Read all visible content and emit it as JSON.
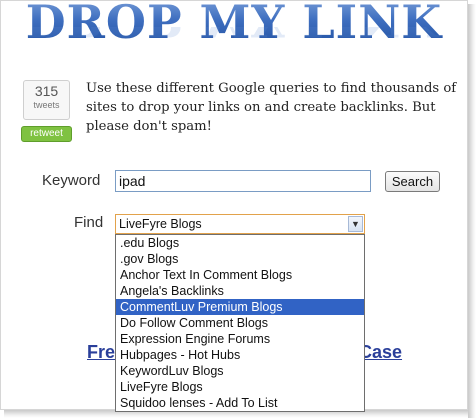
{
  "header": {
    "logo_text": "DROP MY LINK"
  },
  "tweet": {
    "count": "315",
    "count_label": "tweets",
    "button_label": "retweet"
  },
  "intro": {
    "text": "Use these different Google queries to find thousands of sites to drop your links on and create backlinks. But please don't spam!"
  },
  "form": {
    "keyword_label": "Keyword",
    "keyword_value": "ipad",
    "search_label": "Search",
    "find_label": "Find",
    "find_selected": "LiveFyre Blogs",
    "options": [
      ".edu Blogs",
      ".gov Blogs",
      "Anchor Text In Comment Blogs",
      "Angela's Backlinks",
      "CommentLuv Premium Blogs",
      "Do Follow Comment Blogs",
      "Expression Engine Forums",
      "Hubpages - Hot Hubs",
      "KeywordLuv Blogs",
      "LiveFyre Blogs",
      "Squidoo lenses - Add To List"
    ],
    "highlighted_option": "CommentLuv Premium Blogs"
  },
  "promo": {
    "left_visible": "Fre",
    "right_visible": "Case"
  },
  "colors": {
    "logo_blue": "#2f5eb0",
    "highlight": "#3163c5",
    "retweet_green": "#7fc241",
    "link_blue": "#2a3f9a"
  }
}
